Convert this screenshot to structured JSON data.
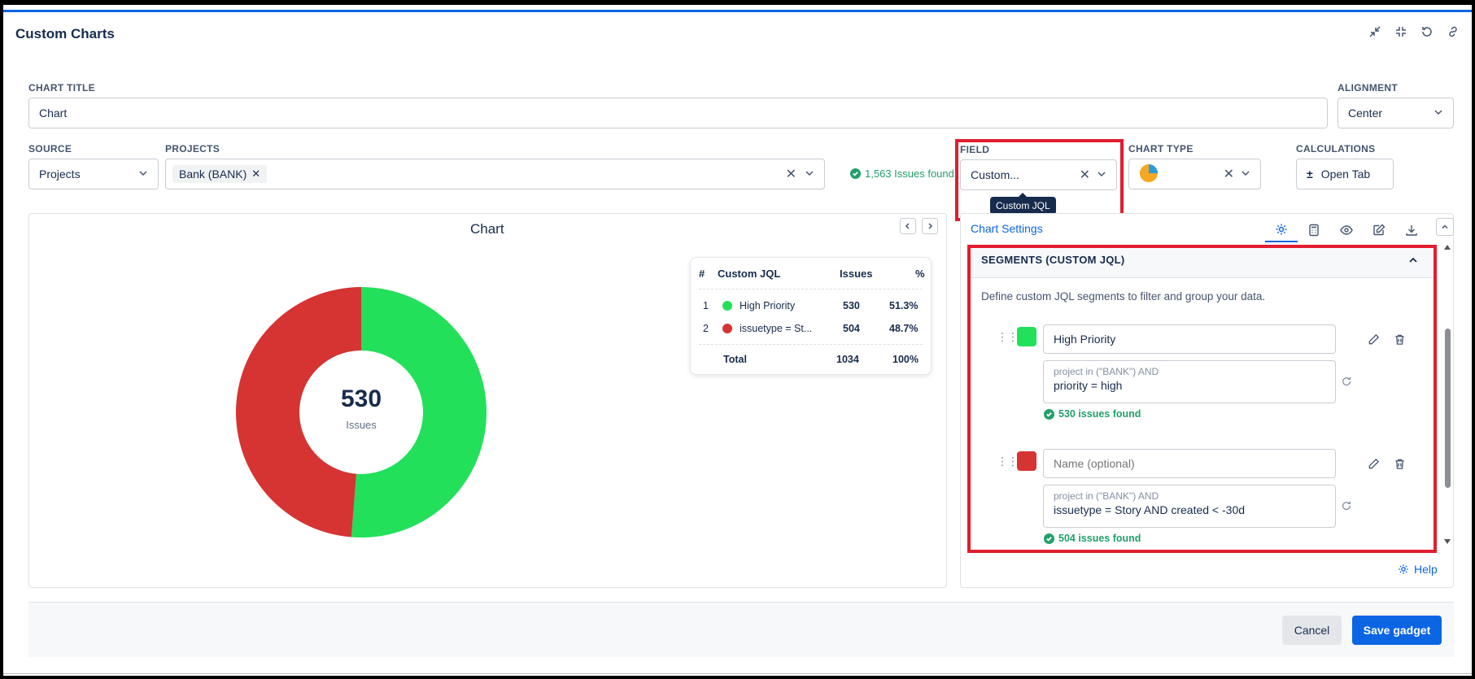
{
  "header": {
    "title": "Custom Charts"
  },
  "form": {
    "chart_title_label": "CHART TITLE",
    "chart_title_value": "Chart",
    "alignment_label": "ALIGNMENT",
    "alignment_value": "Center",
    "source_label": "SOURCE",
    "source_value": "Projects",
    "projects_label": "PROJECTS",
    "project_tag": "Bank (BANK)",
    "issues_found": "1,563 Issues found",
    "field_label": "FIELD",
    "field_value": "Custom...",
    "field_tooltip": "Custom JQL",
    "chart_type_label": "CHART TYPE",
    "calculations_label": "CALCULATIONS",
    "open_tab_label": "Open Tab"
  },
  "chart": {
    "title": "Chart",
    "center_value": "530",
    "center_label": "Issues",
    "legend": {
      "headers": [
        "#",
        "Custom JQL",
        "Issues",
        "%"
      ],
      "rows": [
        {
          "num": "1",
          "name": "High Priority",
          "issues": "530",
          "pct": "51.3%",
          "color": "#22e05a"
        },
        {
          "num": "2",
          "name": "issuetype = St...",
          "issues": "504",
          "pct": "48.7%",
          "color": "#d63333"
        }
      ],
      "total_label": "Total",
      "total_issues": "1034",
      "total_pct": "100%"
    }
  },
  "chart_data": {
    "type": "pie",
    "title": "Chart",
    "categories": [
      "High Priority",
      "issuetype = St..."
    ],
    "values": [
      530,
      504
    ],
    "colors": [
      "#22e05a",
      "#d63333"
    ]
  },
  "settings": {
    "title": "Chart Settings",
    "segments_header": "SEGMENTS (CUSTOM JQL)",
    "segments_desc": "Define custom JQL segments to filter and group your data.",
    "segments": [
      {
        "color": "#22e05a",
        "name": "High Priority",
        "name_placeholder": "Name (optional)",
        "prefix": "project in (\"BANK\") AND",
        "query": "priority = high",
        "found": "530 issues found"
      },
      {
        "color": "#d63333",
        "name": "",
        "name_placeholder": "Name (optional)",
        "prefix": "project in (\"BANK\") AND",
        "query": "issuetype = Story AND created < -30d",
        "found": "504 issues found"
      }
    ],
    "help_label": "Help"
  },
  "footer": {
    "cancel_label": "Cancel",
    "save_label": "Save gadget"
  }
}
